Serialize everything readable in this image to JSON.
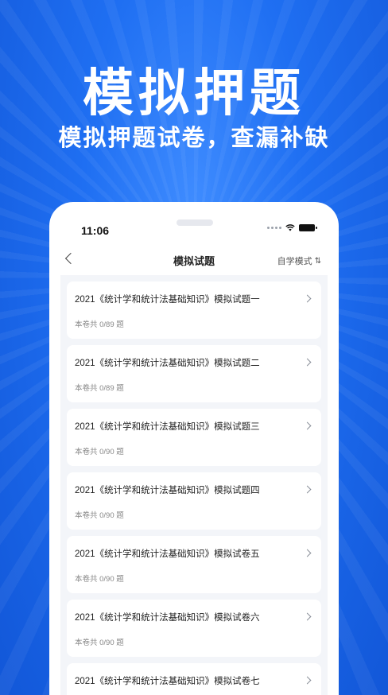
{
  "hero": {
    "title": "模拟押题",
    "subtitle": "模拟押题试卷，查漏补缺"
  },
  "status_bar": {
    "time": "11:06"
  },
  "nav": {
    "title": "模拟试题",
    "mode_label": "自学模式",
    "mode_icon": "⇅"
  },
  "items": [
    {
      "title": "2021《统计学和统计法基础知识》模拟试题一",
      "meta": "本卷共 0/89 题"
    },
    {
      "title": "2021《统计学和统计法基础知识》模拟试题二",
      "meta": "本卷共 0/89 题"
    },
    {
      "title": "2021《统计学和统计法基础知识》模拟试题三",
      "meta": "本卷共 0/90 题"
    },
    {
      "title": "2021《统计学和统计法基础知识》模拟试题四",
      "meta": "本卷共 0/90 题"
    },
    {
      "title": "2021《统计学和统计法基础知识》模拟试卷五",
      "meta": "本卷共 0/90 题"
    },
    {
      "title": "2021《统计学和统计法基础知识》模拟试卷六",
      "meta": "本卷共 0/90 题"
    },
    {
      "title": "2021《统计学和统计法基础知识》模拟试卷七",
      "meta": ""
    }
  ],
  "colors": {
    "brand_blue": "#1f6ff2",
    "list_bg": "#f3f5f9"
  }
}
